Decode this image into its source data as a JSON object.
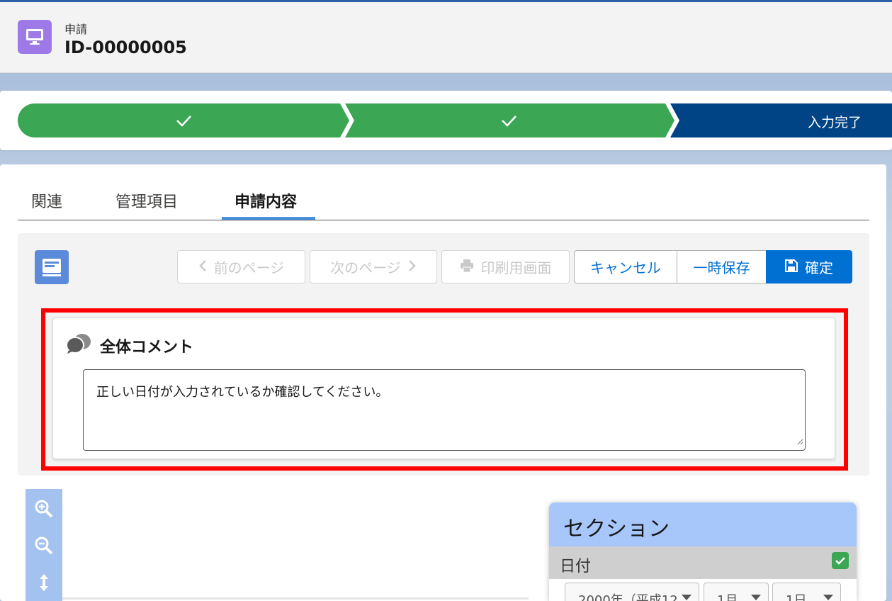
{
  "header": {
    "object_type": "申請",
    "record_title": "ID-00000005"
  },
  "path": {
    "steps": [
      {
        "state": "complete",
        "color": "#3ba755"
      },
      {
        "state": "complete",
        "color": "#3ba755"
      },
      {
        "state": "current",
        "label": "入力完了",
        "color": "#014486"
      }
    ]
  },
  "tabs": {
    "items": [
      "関連",
      "管理項目",
      "申請内容"
    ],
    "active": "申請内容"
  },
  "toolbar": {
    "prev_label": "前のページ",
    "next_label": "次のページ",
    "print_label": "印刷用画面",
    "cancel_label": "キャンセル",
    "temp_save_label": "一時保存",
    "confirm_label": "確定"
  },
  "comment": {
    "title": "全体コメント",
    "text": "正しい日付が入力されているか確認してください。"
  },
  "section": {
    "title": "セクション",
    "row_label": "日付",
    "year_value": "2000年（平成12",
    "month_value": "1月",
    "day_value": "1日"
  },
  "colors": {
    "accent": "#0070d2",
    "highlight": "#ff0000",
    "path_complete": "#3ba755",
    "path_current": "#014486",
    "section_header": "#a7c7fb"
  }
}
